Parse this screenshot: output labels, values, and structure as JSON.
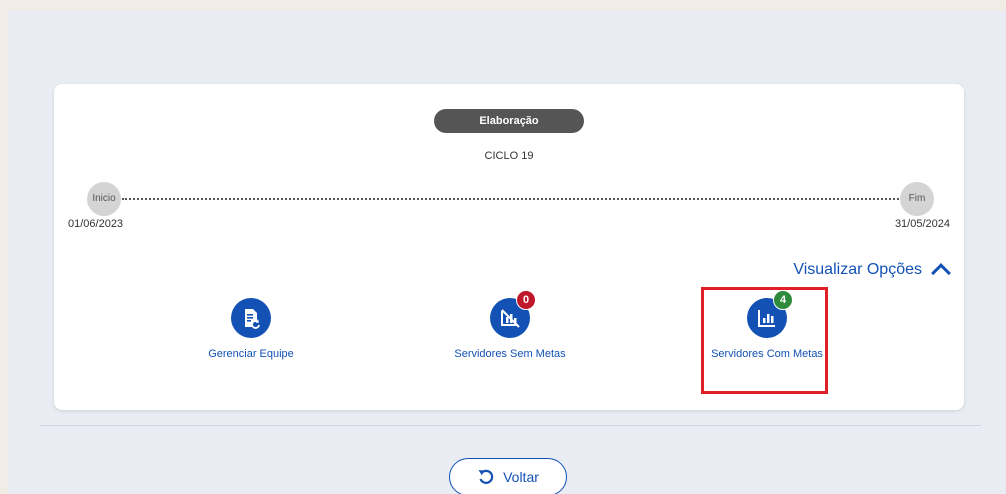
{
  "status": {
    "label": "Elaboração"
  },
  "cycle": {
    "name": "CICLO 19"
  },
  "timeline": {
    "start_label": "Inicio",
    "end_label": "Fim",
    "start_date": "01/06/2023",
    "end_date": "31/05/2024"
  },
  "view_options": {
    "label": "Visualizar Opções",
    "icon": "chevron-up-icon"
  },
  "actions": [
    {
      "label": "Gerenciar Equipe",
      "icon": "manage-team-icon"
    },
    {
      "label": "Servidores Sem Metas",
      "icon": "no-goals-icon",
      "badge": "0",
      "badge_color": "#c0182b"
    },
    {
      "label": "Servidores Com Metas",
      "icon": "goals-chart-icon",
      "badge": "4",
      "badge_color": "#2f8a3b"
    }
  ],
  "back_button": {
    "label": "Voltar",
    "icon": "undo-icon"
  },
  "colors": {
    "primary": "#1351b4",
    "status_bg": "#555555",
    "highlight": "#e01f26"
  }
}
